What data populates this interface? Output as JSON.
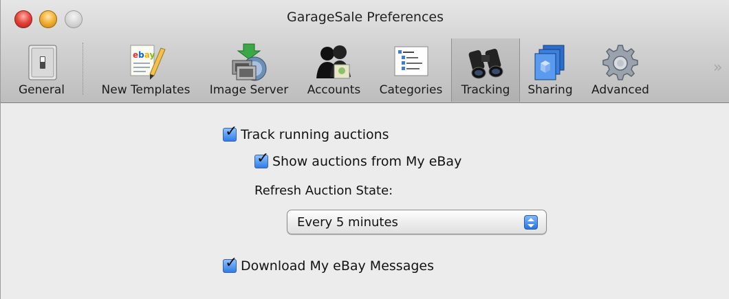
{
  "window": {
    "title": "GarageSale Preferences"
  },
  "toolbar": {
    "items": [
      {
        "label": "General",
        "icon": "light-switch-icon"
      },
      {
        "label": "New Templates",
        "icon": "ebay-template-pencil-icon"
      },
      {
        "label": "Image Server",
        "icon": "image-upload-server-icon"
      },
      {
        "label": "Accounts",
        "icon": "user-accounts-icon"
      },
      {
        "label": "Categories",
        "icon": "category-list-icon"
      },
      {
        "label": "Tracking",
        "icon": "binoculars-icon",
        "selected": true
      },
      {
        "label": "Sharing",
        "icon": "stacked-boxes-icon"
      },
      {
        "label": "Advanced",
        "icon": "gear-icon"
      }
    ],
    "overflow_label": "»"
  },
  "tracking": {
    "track_running": {
      "label": "Track running auctions",
      "checked": true
    },
    "show_my_ebay": {
      "label": "Show auctions from My eBay",
      "checked": true
    },
    "refresh_label": "Refresh Auction State:",
    "refresh_value": "Every 5 minutes",
    "download_messages": {
      "label": "Download My eBay Messages",
      "checked": true
    }
  },
  "colors": {
    "checkbox_accent": "#2f7ce8",
    "selected_tab_bg": "#b8b8b8"
  }
}
